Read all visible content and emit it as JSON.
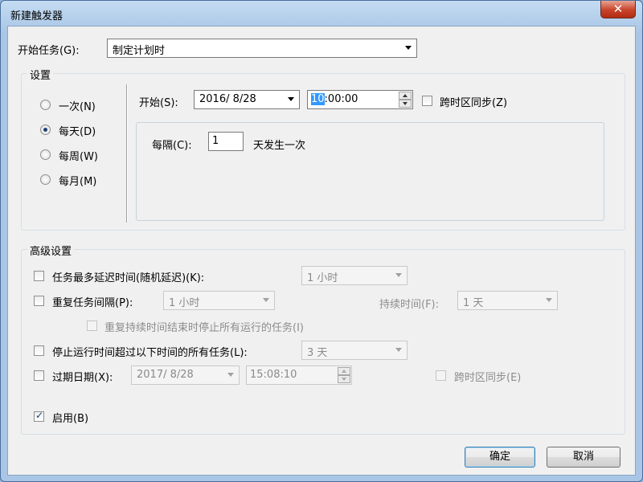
{
  "window": {
    "title": "新建触发器",
    "close_glyph": "✕"
  },
  "begin_task": {
    "label": "开始任务(G):",
    "value": "制定计划时"
  },
  "settings": {
    "title": "设置",
    "schedule_options": [
      {
        "label": "一次(N)",
        "checked": false
      },
      {
        "label": "每天(D)",
        "checked": true
      },
      {
        "label": "每周(W)",
        "checked": false
      },
      {
        "label": "每月(M)",
        "checked": false
      }
    ],
    "start_label": "开始(S):",
    "start_date": "2016/  8/28",
    "start_time_selected": "10",
    "start_time_rest": ":00:00",
    "sync_label": "跨时区同步(Z)",
    "recur_label": "每隔(C):",
    "recur_value": "1",
    "recur_unit": "天发生一次"
  },
  "advanced": {
    "title": "高级设置",
    "delay_label": "任务最多延迟时间(随机延迟)(K):",
    "delay_value": "1 小时",
    "repeat_label": "重复任务间隔(P):",
    "repeat_value": "1 小时",
    "duration_label": "持续时间(F):",
    "duration_value": "1 天",
    "stop_at_end_label": "重复持续时间结束时停止所有运行的任务(I)",
    "stop_longer_label": "停止运行时间超过以下时间的所有任务(L):",
    "stop_longer_value": "3 天",
    "expire_label": "过期日期(X):",
    "expire_date": "2017/  8/28",
    "expire_time": "15:08:10",
    "expire_sync_label": "跨时区同步(E)",
    "enabled_label": "启用(B)"
  },
  "buttons": {
    "ok": "确定",
    "cancel": "取消"
  }
}
